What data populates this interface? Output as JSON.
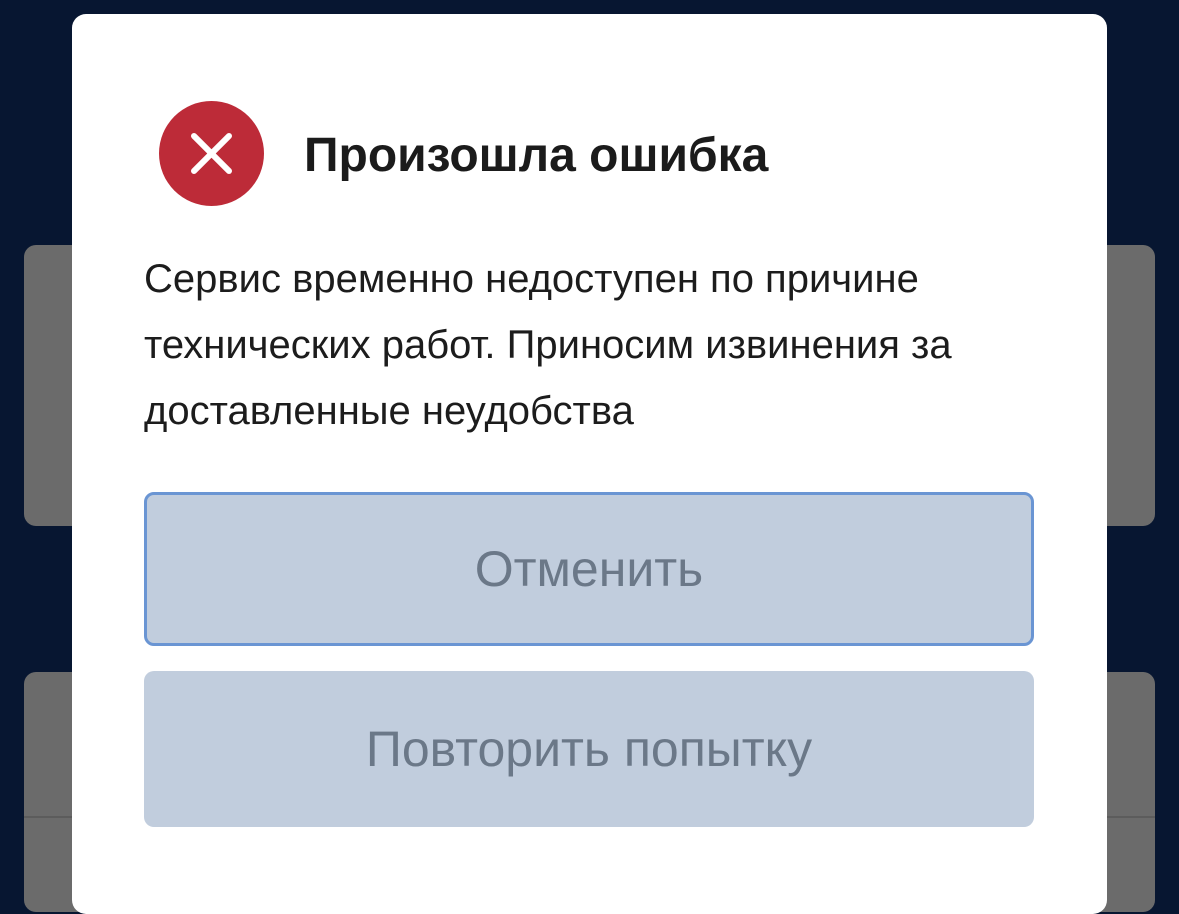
{
  "dialog": {
    "title": "Произошла ошибка",
    "message": "Сервис временно недоступен по причине технических работ. Приносим извинения за доставленные неудобства",
    "icon": "error-x-icon",
    "cancel_label": "Отменить",
    "retry_label": "Повторить попытку"
  },
  "colors": {
    "backdrop": "#071631",
    "error": "#bd2b38",
    "button_bg": "#c1cddd",
    "button_text": "#6b7888",
    "focus_border": "#6a95d3"
  }
}
